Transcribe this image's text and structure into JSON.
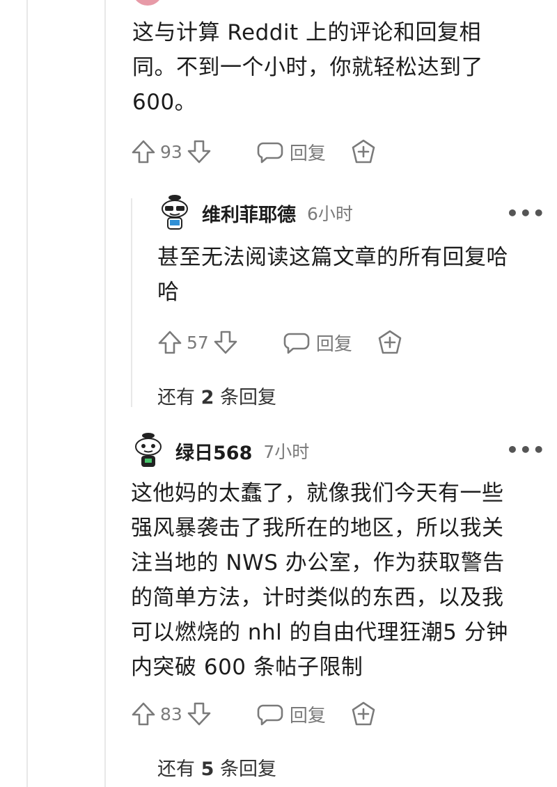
{
  "comment_top": {
    "body": "这与计算 Reddit 上的评论和回复相\n同。不到一个小时，你就轻松达到了\n600。",
    "votes": "93",
    "reply_label": "回复"
  },
  "reply_1": {
    "username": "维利菲耶德",
    "time": "6小时",
    "body": "甚至无法阅读这篇文章的所有回复哈\n哈",
    "votes": "57",
    "reply_label": "回复",
    "more": {
      "prefix": "还有 ",
      "count": "2",
      "suffix": " 条回复"
    }
  },
  "comment_2": {
    "username": "绿日568",
    "time": "7小时",
    "body": "这他妈的太蠢了，就像我们今天有一些\n强风暴袭击了我所在的地区，所以我关\n注当地的 NWS 办公室，作为获取警告\n的简单方法，计时类似的东西，以及我\n可以燃烧的 nhl 的自由代理狂潮5 分钟\n内突破 600 条帖子限制",
    "votes": "83",
    "reply_label": "回复",
    "more": {
      "prefix": "还有 ",
      "count": "5",
      "suffix": " 条回复"
    }
  },
  "icons": {
    "upvote": "upvote-arrow-icon",
    "downvote": "downvote-arrow-icon",
    "reply": "speech-bubble-icon",
    "award": "award-plus-icon",
    "more": "more-options-icon",
    "avatar": "snoo-avatar-icon"
  },
  "colors": {
    "text": "#1c1c1c",
    "muted": "#7a7a7a",
    "thread_line": "#e8e8e8",
    "avatar_pink": "#e79aa7"
  }
}
